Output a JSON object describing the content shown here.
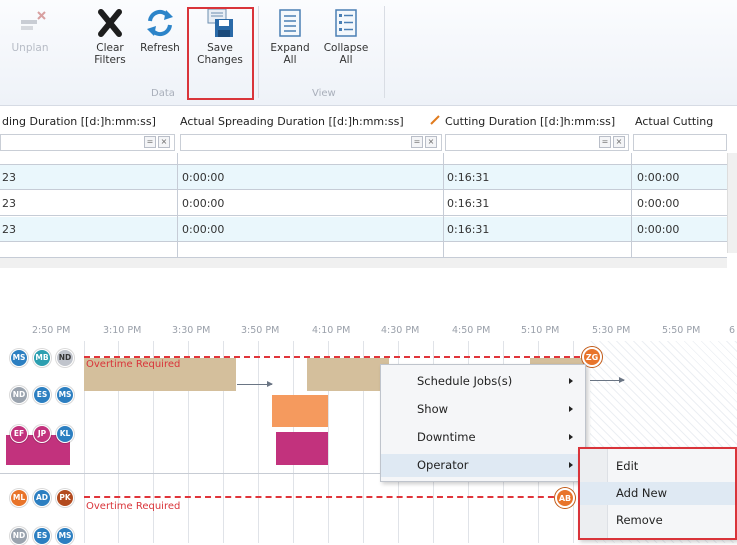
{
  "ribbon": {
    "unplan_label": "Unplan",
    "clear_filters_label": "Clear\nFilters",
    "refresh_label": "Refresh",
    "save_changes_label": "Save\nChanges",
    "data_group_label": "Data",
    "expand_all_label": "Expand\nAll",
    "collapse_all_label": "Collapse\nAll",
    "view_group_label": "View"
  },
  "grid": {
    "headers": [
      "ding Duration [[d:]h:mm:ss]",
      "Actual Spreading Duration [[d:]h:mm:ss]",
      "Cutting Duration [[d:]h:mm:ss]",
      "Actual Cutting"
    ],
    "rows": [
      [
        "23",
        "0:00:00",
        "0:16:31",
        "0:00:00"
      ],
      [
        "23",
        "0:00:00",
        "0:16:31",
        "0:00:00"
      ],
      [
        "23",
        "0:00:00",
        "0:16:31",
        "0:00:00"
      ]
    ]
  },
  "gantt": {
    "ticks": [
      "2:50 PM",
      "3:10 PM",
      "3:30 PM",
      "3:50 PM",
      "4:10 PM",
      "4:30 PM",
      "4:50 PM",
      "5:10 PM",
      "5:30 PM",
      "5:50 PM",
      "6"
    ],
    "overtime_label": "Overtime Required",
    "lane1_avatars": [
      [
        "MS",
        "#2c7fc1"
      ],
      [
        "MB",
        "#2c9fb0"
      ],
      [
        "ND",
        "#c0c4cc"
      ],
      [
        "ND",
        "#9aa3ae"
      ],
      [
        "ES",
        "#2c7fc1"
      ],
      [
        "MS",
        "#2c7fc1"
      ],
      [
        "EF",
        "#c2327d"
      ],
      [
        "JP",
        "#c2327d"
      ],
      [
        "KL",
        "#2c7fc1"
      ]
    ],
    "lane2_avatars": [
      [
        "ML",
        "#e8742a"
      ],
      [
        "AD",
        "#2c7fc1"
      ],
      [
        "PK",
        "#b34a1e"
      ],
      [
        "ND",
        "#9aa3ae"
      ],
      [
        "ES",
        "#2c7fc1"
      ],
      [
        "MS",
        "#2c7fc1"
      ]
    ],
    "badge1": "ZG",
    "badge2": "AB"
  },
  "context_menu": {
    "items": [
      "Schedule Jobs(s)",
      "Show",
      "Downtime",
      "Operator"
    ]
  },
  "operator_submenu": {
    "items": [
      "Edit",
      "Add New",
      "Remove"
    ]
  },
  "colors": {
    "accent_red": "#d9343a",
    "tan_bar": "#d4bf9c",
    "orange_bar": "#f59a5e",
    "magenta_bar": "#c2327d",
    "row_alt": "#eaf7fc"
  }
}
